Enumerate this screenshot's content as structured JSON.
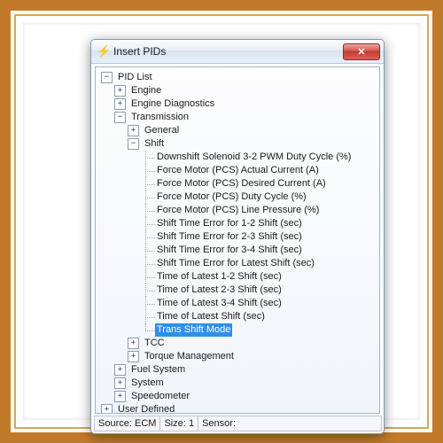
{
  "window": {
    "title": "Insert PIDs",
    "close_glyph": "✕",
    "icon_glyph": "⚡"
  },
  "tree": {
    "root": {
      "label": "PID List",
      "expanded": true
    },
    "engine": {
      "label": "Engine"
    },
    "engine_diag": {
      "label": "Engine Diagnostics"
    },
    "transmission": {
      "label": "Transmission",
      "expanded": true
    },
    "general": {
      "label": "General"
    },
    "shift": {
      "label": "Shift",
      "expanded": true
    },
    "shift_items": [
      "Downshift Solenoid 3-2 PWM Duty Cycle   (%)",
      "Force Motor (PCS) Actual Current   (A)",
      "Force Motor (PCS) Desired Current   (A)",
      "Force Motor (PCS) Duty Cycle   (%)",
      "Force Motor (PCS) Line Pressure   (%)",
      "Shift Time Error for 1-2 Shift   (sec)",
      "Shift Time Error for 2-3 Shift   (sec)",
      "Shift Time Error for 3-4 Shift   (sec)",
      "Shift Time Error for Latest Shift   (sec)",
      "Time of Latest 1-2 Shift   (sec)",
      "Time of Latest 2-3 Shift   (sec)",
      "Time of Latest 3-4 Shift   (sec)",
      "Time of Latest Shift   (sec)",
      "Trans Shift Mode"
    ],
    "shift_selected_index": 13,
    "tcc": {
      "label": "TCC"
    },
    "torque": {
      "label": "Torque Management"
    },
    "fuel": {
      "label": "Fuel System"
    },
    "system": {
      "label": "System"
    },
    "speedo": {
      "label": "Speedometer"
    },
    "user_defined": {
      "label": "User Defined"
    }
  },
  "status": {
    "source_label": "Source:",
    "source_value": "ECM",
    "size_label": "Size:",
    "size_value": "1",
    "sensor_label": "Sensor:"
  },
  "glyphs": {
    "plus": "+",
    "minus": "−"
  }
}
